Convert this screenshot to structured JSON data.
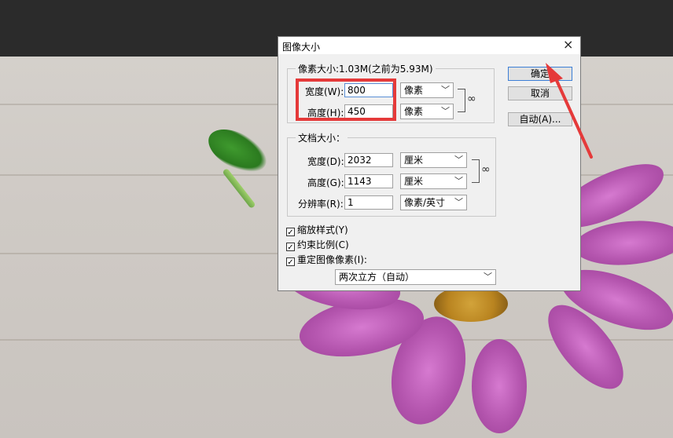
{
  "dialog": {
    "title": "图像大小",
    "pixel_group": {
      "title": "像素大小:1.03M(之前为5.93M)",
      "width_label": "宽度(W):",
      "width_value": "800",
      "width_unit": "像素",
      "height_label": "高度(H):",
      "height_value": "450",
      "height_unit": "像素"
    },
    "doc_group": {
      "title": "文档大小：",
      "width_label": "宽度(D):",
      "width_value": "2032",
      "width_unit": "厘米",
      "height_label": "高度(G):",
      "height_value": "1143",
      "height_unit": "厘米",
      "res_label": "分辨率(R):",
      "res_value": "1",
      "res_unit": "像素/英寸"
    },
    "checkboxes": {
      "scale_styles": "缩放样式(Y)",
      "constrain": "约束比例(C)",
      "resample": "重定图像像素(I):"
    },
    "resample_method": "两次立方（自动）",
    "buttons": {
      "ok": "确定",
      "cancel": "取消",
      "auto": "自动(A)..."
    }
  },
  "icons": {
    "close": "close-icon",
    "chain": "chain-link-icon",
    "dropdown": "chevron-down-icon",
    "check": "checkmark-icon"
  },
  "colors": {
    "annotation": "#e53a3a",
    "default_button_border": "#3c7fd6"
  }
}
